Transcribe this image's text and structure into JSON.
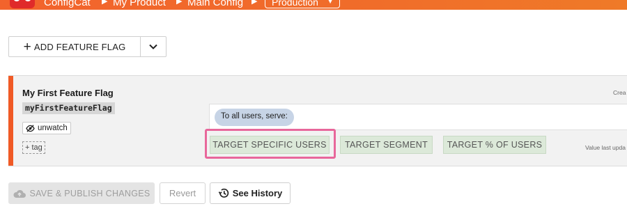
{
  "header": {
    "breadcrumbs": [
      "ConfigCat",
      "My Product",
      "Main Config"
    ],
    "environment": "Production"
  },
  "toolbar": {
    "add_label": "ADD FEATURE FLAG"
  },
  "flag": {
    "name": "My First Feature Flag",
    "key": "myFirstFeatureFlag",
    "unwatch_label": "unwatch",
    "tag_label": "+ tag",
    "created_text": "Crea",
    "serve_label": "To all users, serve:",
    "rules": [
      "TARGET SPECIFIC USERS",
      "TARGET SEGMENT",
      "TARGET % OF USERS"
    ],
    "value_updated_text": "Value last upda"
  },
  "footer": {
    "save_label": "SAVE & PUBLISH CHANGES",
    "revert_label": "Revert",
    "history_label": "See History"
  },
  "colors": {
    "header": "#f2632c",
    "accent": "#f05a26",
    "highlight": "#e8679b",
    "rule_bg": "#dce9d9",
    "serve_pill": "#c7d4e6"
  }
}
